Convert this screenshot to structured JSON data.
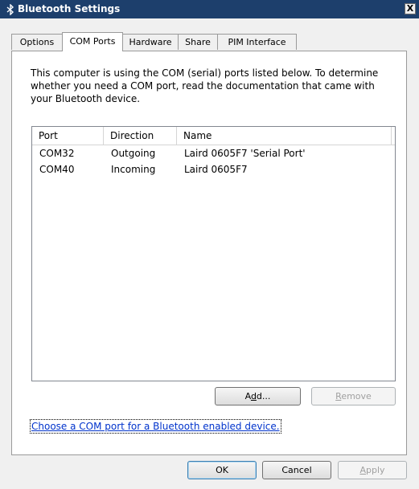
{
  "window": {
    "title": "Bluetooth Settings",
    "close_label": "X"
  },
  "tabs": [
    {
      "label": "Options"
    },
    {
      "label": "COM Ports",
      "active": true
    },
    {
      "label": "Hardware"
    },
    {
      "label": "Share"
    },
    {
      "label": "PIM Interface"
    }
  ],
  "com_ports": {
    "description": "This computer is using the COM (serial) ports listed below. To determine whether you need a COM port, read the documentation that came with your Bluetooth device.",
    "columns": [
      "Port",
      "Direction",
      "Name"
    ],
    "rows": [
      {
        "port": "COM32",
        "direction": "Outgoing",
        "name": "Laird 0605F7 'Serial Port'"
      },
      {
        "port": "COM40",
        "direction": "Incoming",
        "name": "Laird 0605F7"
      }
    ],
    "add_button_prefix": "A",
    "add_button_accel": "d",
    "add_button_suffix": "d...",
    "remove_button_accel": "R",
    "remove_button_suffix": "emove",
    "link_text": "Choose a COM port for a Bluetooth enabled device."
  },
  "footer": {
    "ok_label": "OK",
    "cancel_label": "Cancel",
    "apply_accel": "A",
    "apply_suffix": "pply"
  },
  "colors": {
    "titlebar": "#1d3f6c",
    "link": "#0033cc"
  }
}
